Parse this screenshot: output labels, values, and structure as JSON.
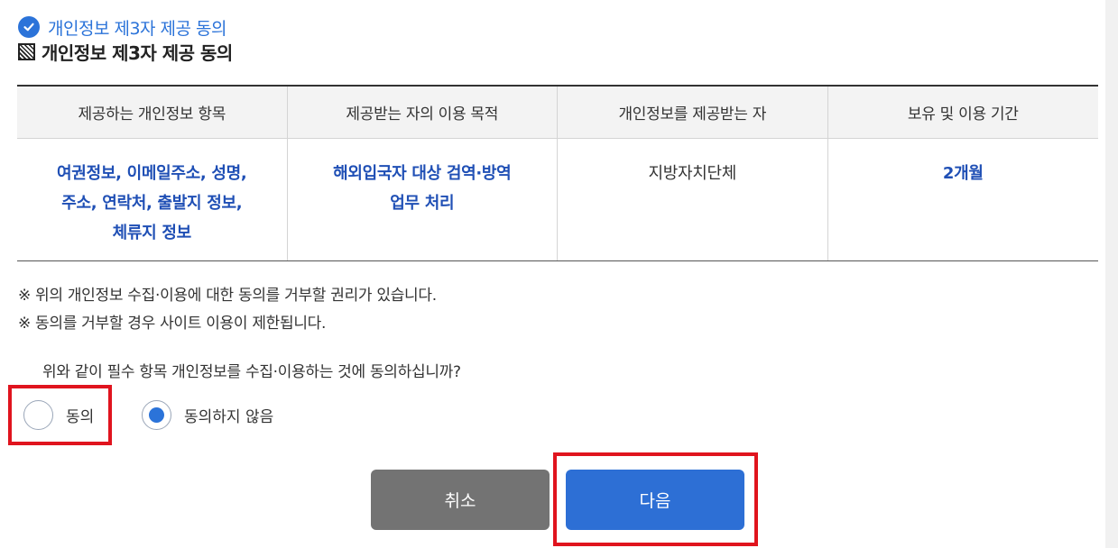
{
  "section": {
    "subtitle": "개인정보 제3자 제공 동의",
    "title": "개인정보 제3자 제공 동의"
  },
  "table": {
    "headers": [
      "제공하는 개인정보 항목",
      "제공받는 자의 이용 목적",
      "개인정보를 제공받는 자",
      "보유 및 이용 기간"
    ],
    "row": {
      "items": [
        "여권정보, 이메일주소, 성명,",
        "주소, 연락처, 출발지 정보,",
        "체류지 정보"
      ],
      "purpose": [
        "해외입국자 대상 검역·방역",
        "업무 처리"
      ],
      "recipient": "지방자치단체",
      "period": "2개월"
    }
  },
  "notes": [
    "※ 위의 개인정보 수집·이용에 대한 동의를 거부할 권리가 있습니다.",
    "※ 동의를 거부할 경우 사이트 이용이 제한됩니다."
  ],
  "question": "위와 같이 필수 항목 개인정보를 수집·이용하는 것에 동의하십니까?",
  "radios": {
    "agree_label": "동의",
    "disagree_label": "동의하지 않음",
    "selected": "disagree"
  },
  "buttons": {
    "cancel_label": "취소",
    "next_label": "다음"
  },
  "colors": {
    "accent": "#2b73d9",
    "table_highlight_text": "#1f4fb5",
    "cancel_button": "#737373",
    "next_button": "#2d6fd5",
    "highlight_box": "#e0141e"
  },
  "icons": {
    "subtitle_icon": "check-circle-icon",
    "title_icon": "hatched-square-icon"
  }
}
